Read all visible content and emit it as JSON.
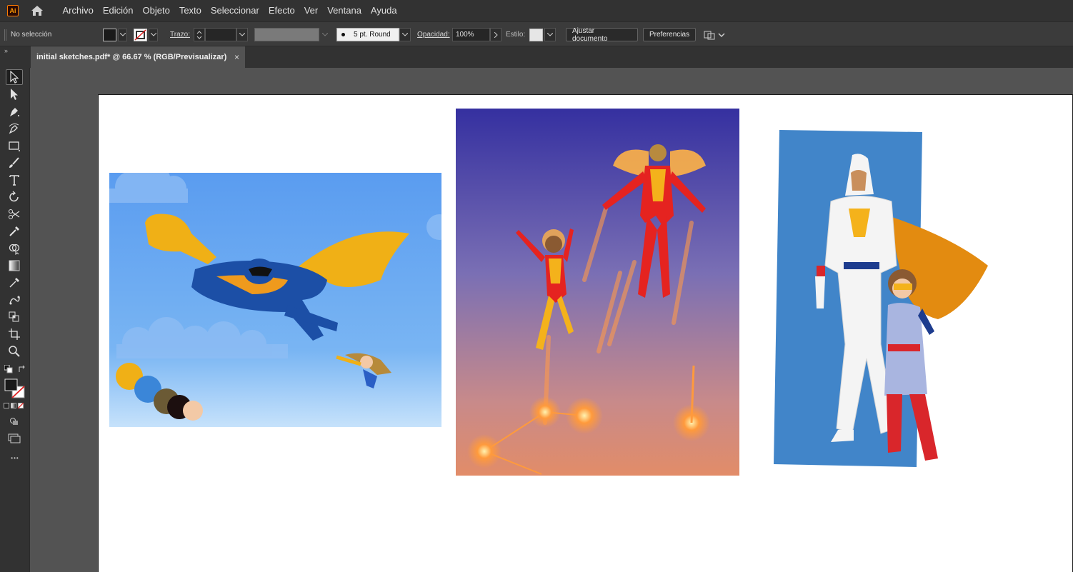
{
  "app": {
    "logo_text": "Ai"
  },
  "menu": [
    "Archivo",
    "Edición",
    "Objeto",
    "Texto",
    "Seleccionar",
    "Efecto",
    "Ver",
    "Ventana",
    "Ayuda"
  ],
  "control_bar": {
    "selection_status": "No selección",
    "stroke_label": "Trazo:",
    "brush_value": "5 pt. Round",
    "opacity_label": "Opacidad:",
    "opacity_value": "100%",
    "style_label": "Estilo:",
    "adjust_document_button": "Ajustar documento",
    "preferences_button": "Preferencias"
  },
  "document_tab": {
    "title": "initial sketches.pdf* @ 66.67 % (RGB/Previsualizar)",
    "close_glyph": "×"
  },
  "toolbar": {
    "tools": [
      "selection-tool",
      "direct-selection-tool",
      "pen-tool",
      "curvature-tool",
      "rectangle-tool",
      "paintbrush-tool",
      "type-tool",
      "rotate-tool",
      "scissors-tool",
      "eyedropper-tool",
      "shape-builder-tool",
      "gradient-tool",
      "eyedropper-tool-2",
      "puppet-warp-tool",
      "live-paint-tool",
      "artboard-tool",
      "zoom-tool"
    ],
    "more_glyph": "•••"
  },
  "colors": {
    "fill": "#1a1a1a",
    "panel_bg": "#323232",
    "canvas_bg": "#535353",
    "accent_orange": "#ff9a00"
  },
  "artwork": {
    "palette_swatches": [
      "#f0b016",
      "#3b86d8",
      "#6b5a35",
      "#1c0f0f",
      "#f3c9a6"
    ]
  }
}
